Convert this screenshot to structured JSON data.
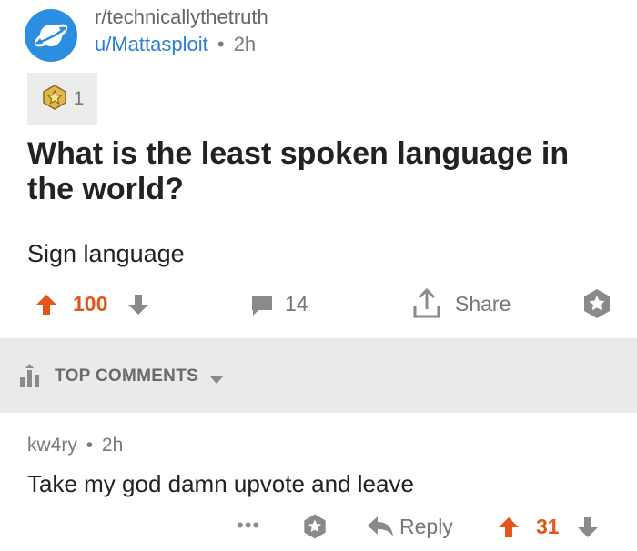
{
  "post": {
    "subreddit": "r/technicallythetruth",
    "author": "u/Mattasploit",
    "separator": "•",
    "age": "2h",
    "award_count": "1",
    "title": "What is the least spoken language in the world?",
    "body": "Sign language",
    "score": "100",
    "comment_count": "14",
    "share_label": "Share"
  },
  "sort": {
    "label": "TOP COMMENTS"
  },
  "comment": {
    "author": "kw4ry",
    "separator": "•",
    "age": "2h",
    "body": "Take my god damn upvote and leave",
    "more": "•••",
    "reply_label": "Reply",
    "score": "31"
  },
  "colors": {
    "upvote": "#e4541b",
    "link": "#2a7fd4",
    "subreddit_icon": "#2b8ee0",
    "sort_bar_bg": "#e9eaeb",
    "icon_gray": "#8a8a8a"
  },
  "icons": {
    "subreddit": "planet-icon",
    "award": "silver-star-award-icon",
    "upvote": "arrow-up-icon",
    "downvote": "arrow-down-icon",
    "comments": "speech-bubble-icon",
    "share": "share-upload-icon",
    "save": "star-outline-icon",
    "sort": "bar-chart-icon",
    "reply": "reply-arrow-icon"
  }
}
